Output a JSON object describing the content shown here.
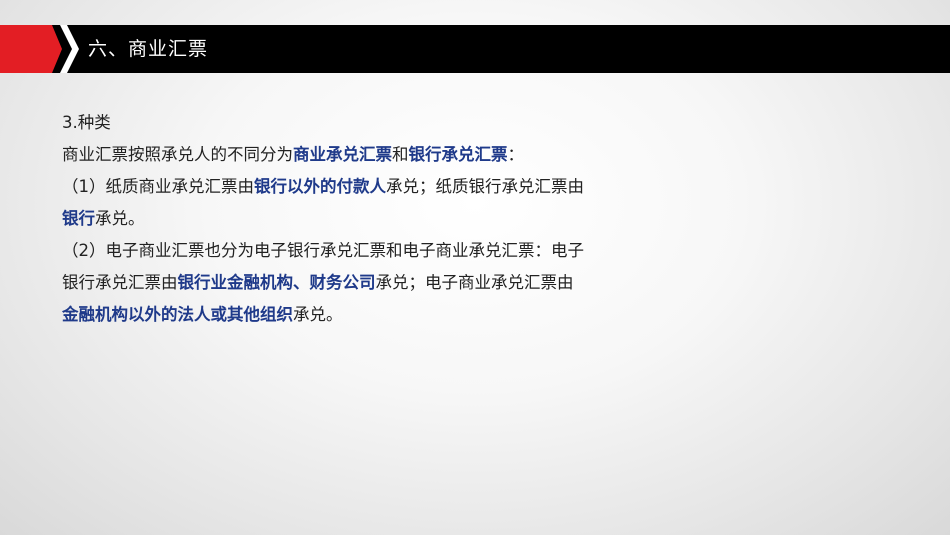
{
  "header": {
    "title": "六、商业汇票"
  },
  "content": {
    "heading": "3.种类",
    "line1": {
      "a": "商业汇票按照承兑人的不同分为",
      "b": "商业承兑汇票",
      "c": "和",
      "d": "银行承兑汇票",
      "e": "："
    },
    "line2": {
      "a": "（1）纸质商业承兑汇票由",
      "b": "银行以外的付款人",
      "c": "承兑；纸质银行承兑汇票由"
    },
    "line3": {
      "a": "银行",
      "b": "承兑。"
    },
    "line4": {
      "a": "（2）电子商业汇票也分为电子银行承兑汇票和电子商业承兑汇票：电子"
    },
    "line5": {
      "a": "银行承兑汇票由",
      "b": "银行业金融机构、财务公司",
      "c": "承兑；电子商业承兑汇票由"
    },
    "line6": {
      "a": "金融机构以外的法人或其他组织",
      "b": "承兑。"
    }
  },
  "colors": {
    "accent_red": "#e31e24",
    "title_bar": "#000000",
    "highlight_blue": "#1f3a8a"
  },
  "icons": [
    "chevron-right-icon"
  ]
}
